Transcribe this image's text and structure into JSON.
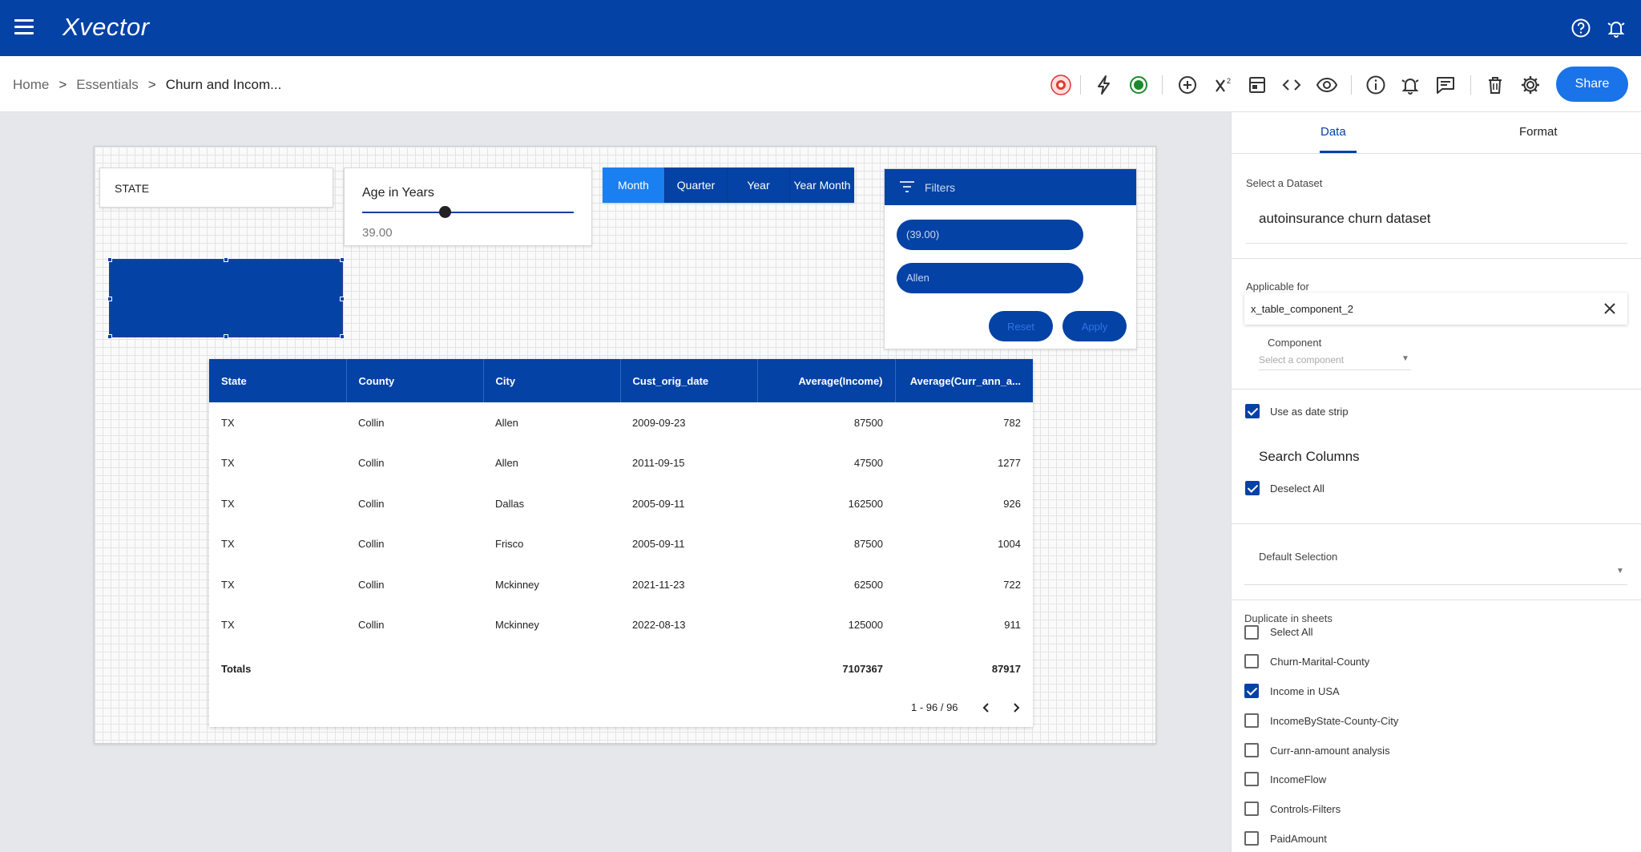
{
  "app": {
    "logo": "Xvector"
  },
  "breadcrumb": {
    "home": "Home",
    "sep1": ">",
    "essentials": "Essentials",
    "sep2": ">",
    "current": "Churn and Incom..."
  },
  "toolbar": {
    "share_label": "Share"
  },
  "widgets": {
    "state_label": "STATE",
    "age": {
      "title": "Age in Years",
      "value": "39.00"
    },
    "date_strip": [
      {
        "label": "Month",
        "active": true
      },
      {
        "label": "Quarter",
        "active": false
      },
      {
        "label": "Year",
        "active": false
      },
      {
        "label": "Year Month",
        "active": false
      }
    ],
    "filters": {
      "title": "Filters",
      "chips": [
        "(39.00)",
        "Allen"
      ],
      "reset_label": "Reset",
      "apply_label": "Apply"
    }
  },
  "table": {
    "columns": [
      "State",
      "County",
      "City",
      "Cust_orig_date",
      "Average(Income)",
      "Average(Curr_ann_a..."
    ],
    "rows": [
      [
        "TX",
        "Collin",
        "Allen",
        "2009-09-23",
        "87500",
        "782"
      ],
      [
        "TX",
        "Collin",
        "Allen",
        "2011-09-15",
        "47500",
        "1277"
      ],
      [
        "TX",
        "Collin",
        "Dallas",
        "2005-09-11",
        "162500",
        "926"
      ],
      [
        "TX",
        "Collin",
        "Frisco",
        "2005-09-11",
        "87500",
        "1004"
      ],
      [
        "TX",
        "Collin",
        "Mckinney",
        "2021-11-23",
        "62500",
        "722"
      ],
      [
        "TX",
        "Collin",
        "Mckinney",
        "2022-08-13",
        "125000",
        "911"
      ]
    ],
    "totals": {
      "label": "Totals",
      "income": "7107367",
      "curr": "87917"
    },
    "pagination": "1 - 96 / 96"
  },
  "panel": {
    "tabs": [
      "Data",
      "Format"
    ],
    "select_dataset_label": "Select a Dataset",
    "dataset": "autoinsurance churn dataset",
    "applicable_label": "Applicable for",
    "applicable_value": "x_table_component_2",
    "component_label": "Component",
    "component_placeholder": "Select a component",
    "use_date_strip": "Use as date strip",
    "search_columns": "Search Columns",
    "deselect_all": "Deselect All",
    "default_selection": "Default Selection",
    "duplicate_label": "Duplicate in sheets",
    "sheets": [
      {
        "label": "Select All",
        "checked": false
      },
      {
        "label": "Churn-Marital-County",
        "checked": false
      },
      {
        "label": "Income in USA",
        "checked": true
      },
      {
        "label": "IncomeByState-County-City",
        "checked": false
      },
      {
        "label": "Curr-ann-amount analysis",
        "checked": false
      },
      {
        "label": "IncomeFlow",
        "checked": false
      },
      {
        "label": "Controls-Filters",
        "checked": false
      },
      {
        "label": "PaidAmount",
        "checked": false
      }
    ]
  },
  "colors": {
    "primary": "#0442a5",
    "accent": "#1a73e8"
  }
}
